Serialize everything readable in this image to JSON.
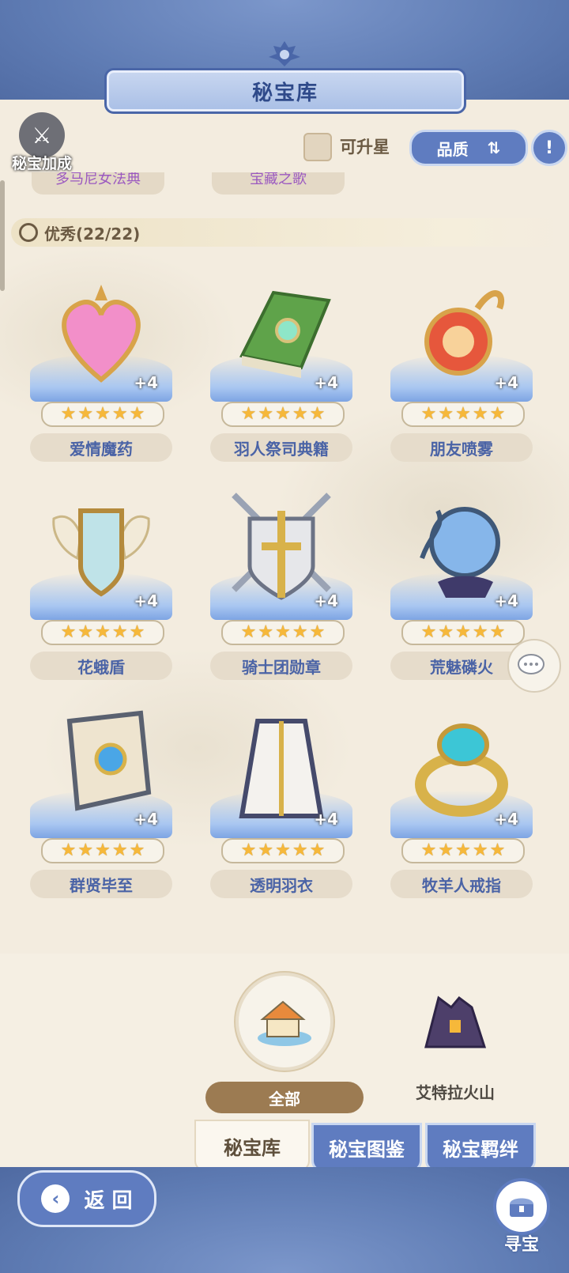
{
  "header": {
    "title": "秘宝库"
  },
  "toolbar": {
    "bonus_label": "秘宝加成",
    "upgradable_label": "可升星",
    "sort_label": "品质"
  },
  "partial_row": [
    "多马尼女法典",
    "宝藏之歌"
  ],
  "section": {
    "label": "优秀(22/22)"
  },
  "items": [
    {
      "name": "爱情魔药",
      "plus": "+4",
      "stars": 5
    },
    {
      "name": "羽人祭司典籍",
      "plus": "+4",
      "stars": 5
    },
    {
      "name": "朋友喷雾",
      "plus": "+4",
      "stars": 5
    },
    {
      "name": "花蛾盾",
      "plus": "+4",
      "stars": 5
    },
    {
      "name": "骑士团勋章",
      "plus": "+4",
      "stars": 5
    },
    {
      "name": "荒魅磷火",
      "plus": "+4",
      "stars": 5
    },
    {
      "name": "群贤毕至",
      "plus": "+4",
      "stars": 5
    },
    {
      "name": "透明羽衣",
      "plus": "+4",
      "stars": 5
    },
    {
      "name": "牧羊人戒指",
      "plus": "+4",
      "stars": 5
    }
  ],
  "regions": [
    {
      "label": "全部",
      "active": true
    },
    {
      "label": "艾特拉火山",
      "active": false
    }
  ],
  "tabs": [
    "秘宝库",
    "秘宝图鉴",
    "秘宝羁绊"
  ],
  "footer": {
    "back_label": "返 回",
    "treasure_label": "寻宝"
  },
  "colors": {
    "accent_blue": "#5f7cc0",
    "star": "#f6b83a",
    "name_text": "#4a63a6",
    "panel": "#f3ecdf"
  }
}
